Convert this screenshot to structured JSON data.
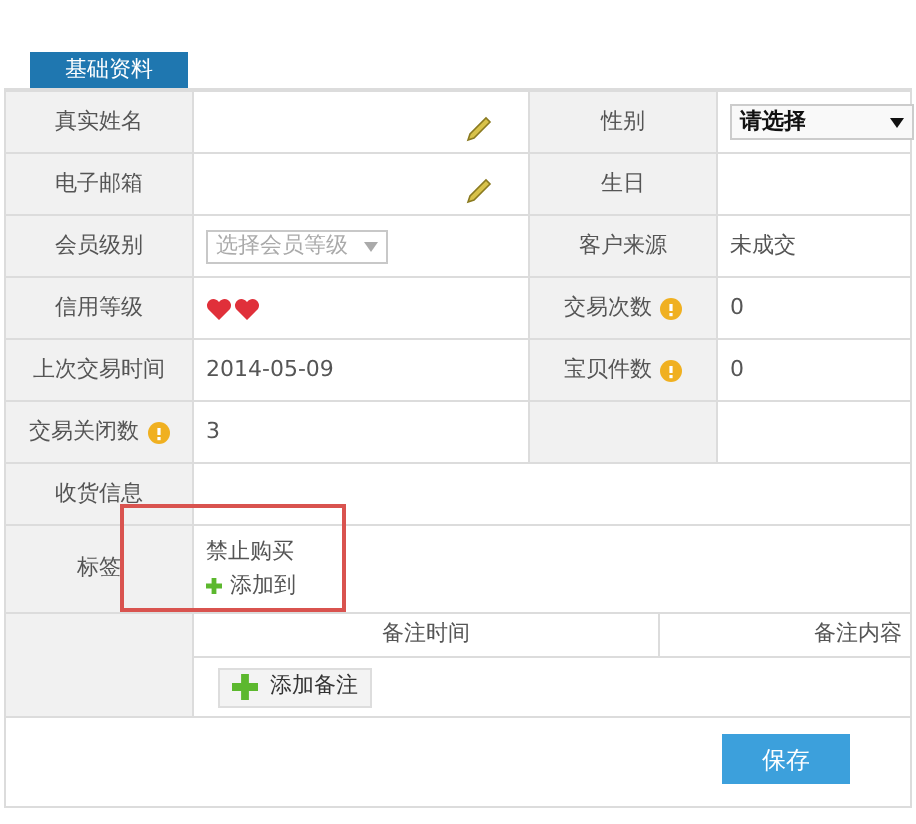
{
  "tab": {
    "label": "基础资料",
    "selected": true
  },
  "rows": [
    {
      "full_width": false,
      "cells": [
        {
          "label": "真实姓名",
          "help": false,
          "kind": "editable"
        },
        {
          "label": "性别",
          "help": false,
          "kind": "select",
          "value": "请选择",
          "disabled": false
        }
      ]
    },
    {
      "full_width": false,
      "cells": [
        {
          "label": "电子邮箱",
          "help": false,
          "kind": "editable"
        },
        {
          "label": "生日",
          "help": false,
          "kind": "text"
        }
      ]
    },
    {
      "full_width": false,
      "cells": [
        {
          "label": "会员级别",
          "help": false,
          "kind": "select",
          "placeholder": "选择会员等级",
          "disabled": true
        },
        {
          "label": "客户来源",
          "help": false,
          "kind": "text",
          "value": "未成交"
        }
      ]
    },
    {
      "full_width": false,
      "cells": [
        {
          "label": "信用等级",
          "help": false,
          "kind": "rating"
        },
        {
          "label": "交易次数",
          "help": true,
          "kind": "text",
          "value": "0"
        }
      ]
    },
    {
      "full_width": false,
      "cells": [
        {
          "label": "上次交易时间",
          "help": false,
          "kind": "text",
          "value": "2014-05-09"
        },
        {
          "label": "宝贝件数",
          "help": true,
          "kind": "text",
          "value": "0"
        }
      ]
    },
    {
      "full_width": false,
      "cells": [
        {
          "label": "交易关闭数",
          "help": true,
          "kind": "text",
          "value": "3"
        }
      ]
    },
    {
      "full_width": true,
      "cells": [
        {
          "label": "收货信息",
          "help": false,
          "kind": "text"
        }
      ]
    },
    {
      "full_width": true,
      "cells": [
        {
          "label": "标签",
          "help": false,
          "kind": "tags",
          "value": "禁止购买",
          "link": "添加到",
          "highlighted": true
        }
      ]
    }
  ],
  "remarks": {
    "columns": [
      "备注时间",
      "备注内容"
    ],
    "add_button": "添加备注"
  },
  "save_button": "保存"
}
